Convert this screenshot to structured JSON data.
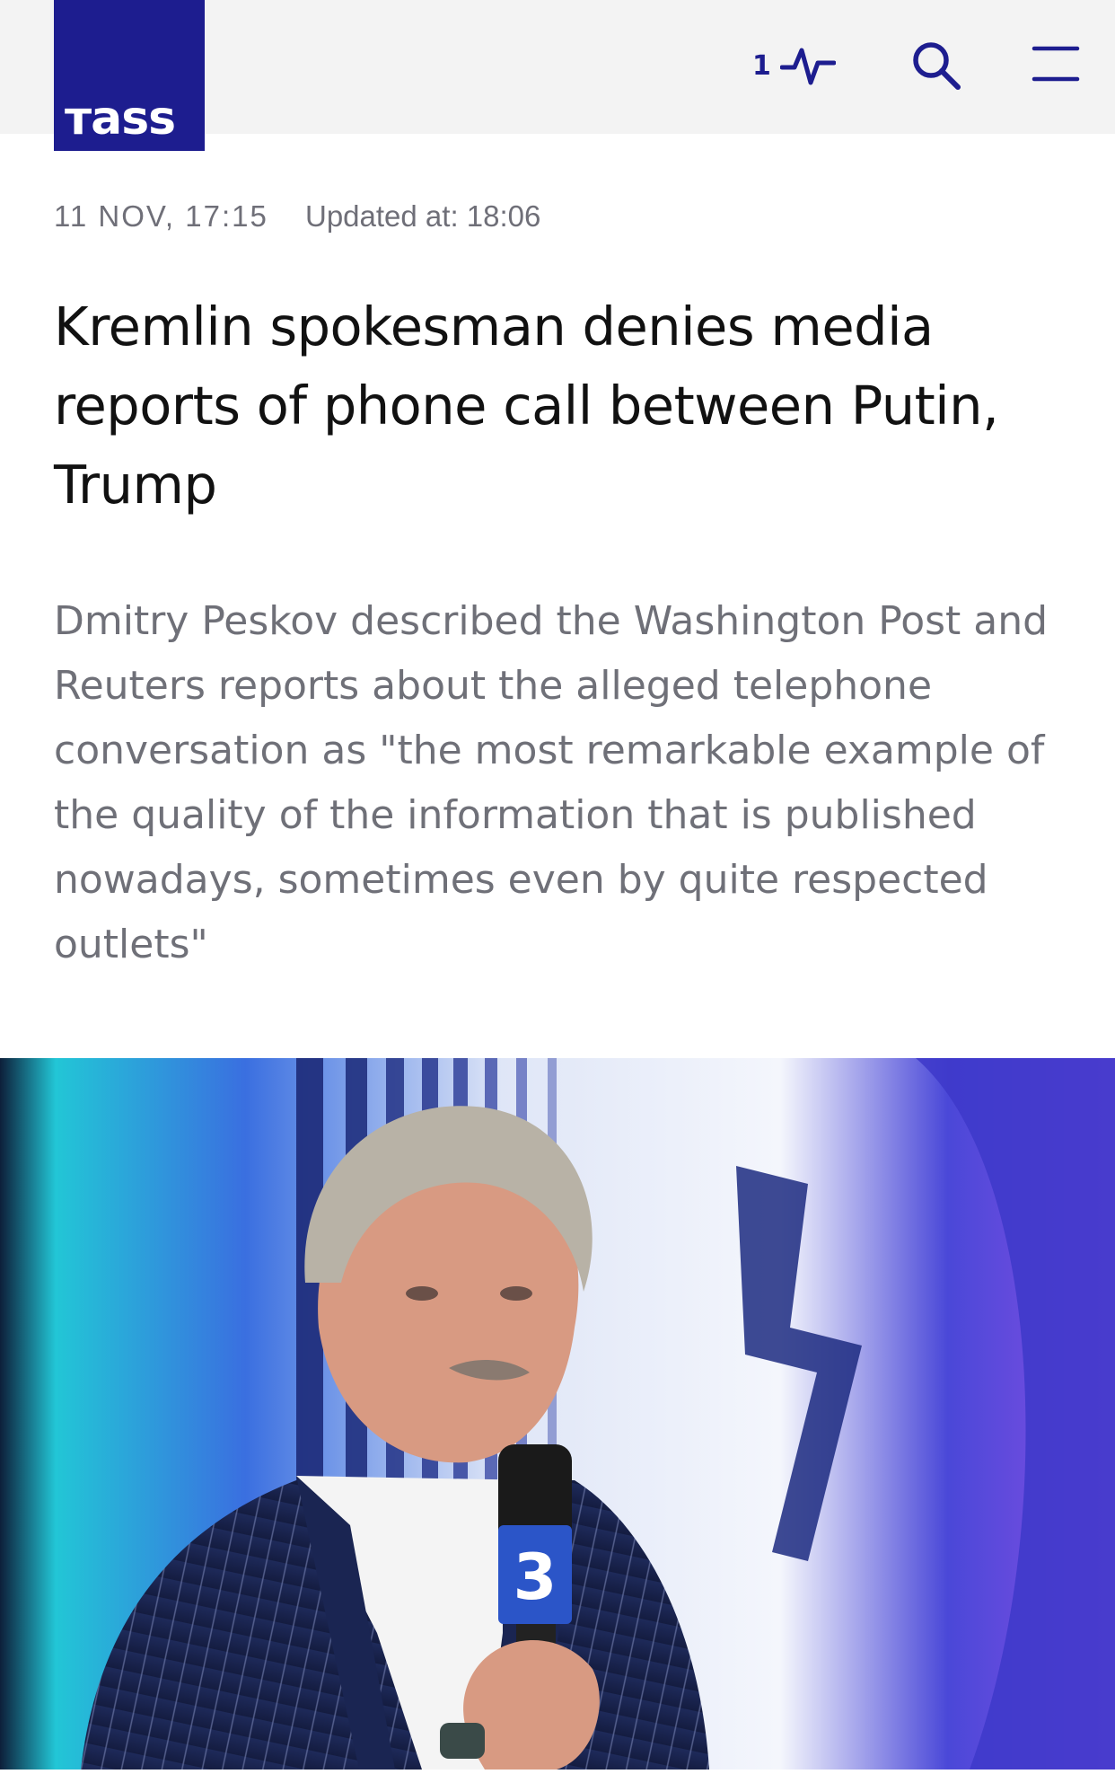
{
  "header": {
    "logo_text": "тass",
    "pulse_count": "1",
    "icons": [
      "pulse-icon",
      "search-icon",
      "menu-icon"
    ],
    "brand_color": "#1d1d8f"
  },
  "article": {
    "date": "11 NOV, 17:15",
    "updated": "Updated at: 18:06",
    "title": "Kremlin spokesman denies media reports of phone call between Putin, Trump",
    "lead": "Dmitry Peskov described the Washington Post and Reuters reports about the alleged telephone conversation as \"the most remarkable example of the quality of the information that is published nowadays, sometimes even by quite respected outlets\""
  }
}
